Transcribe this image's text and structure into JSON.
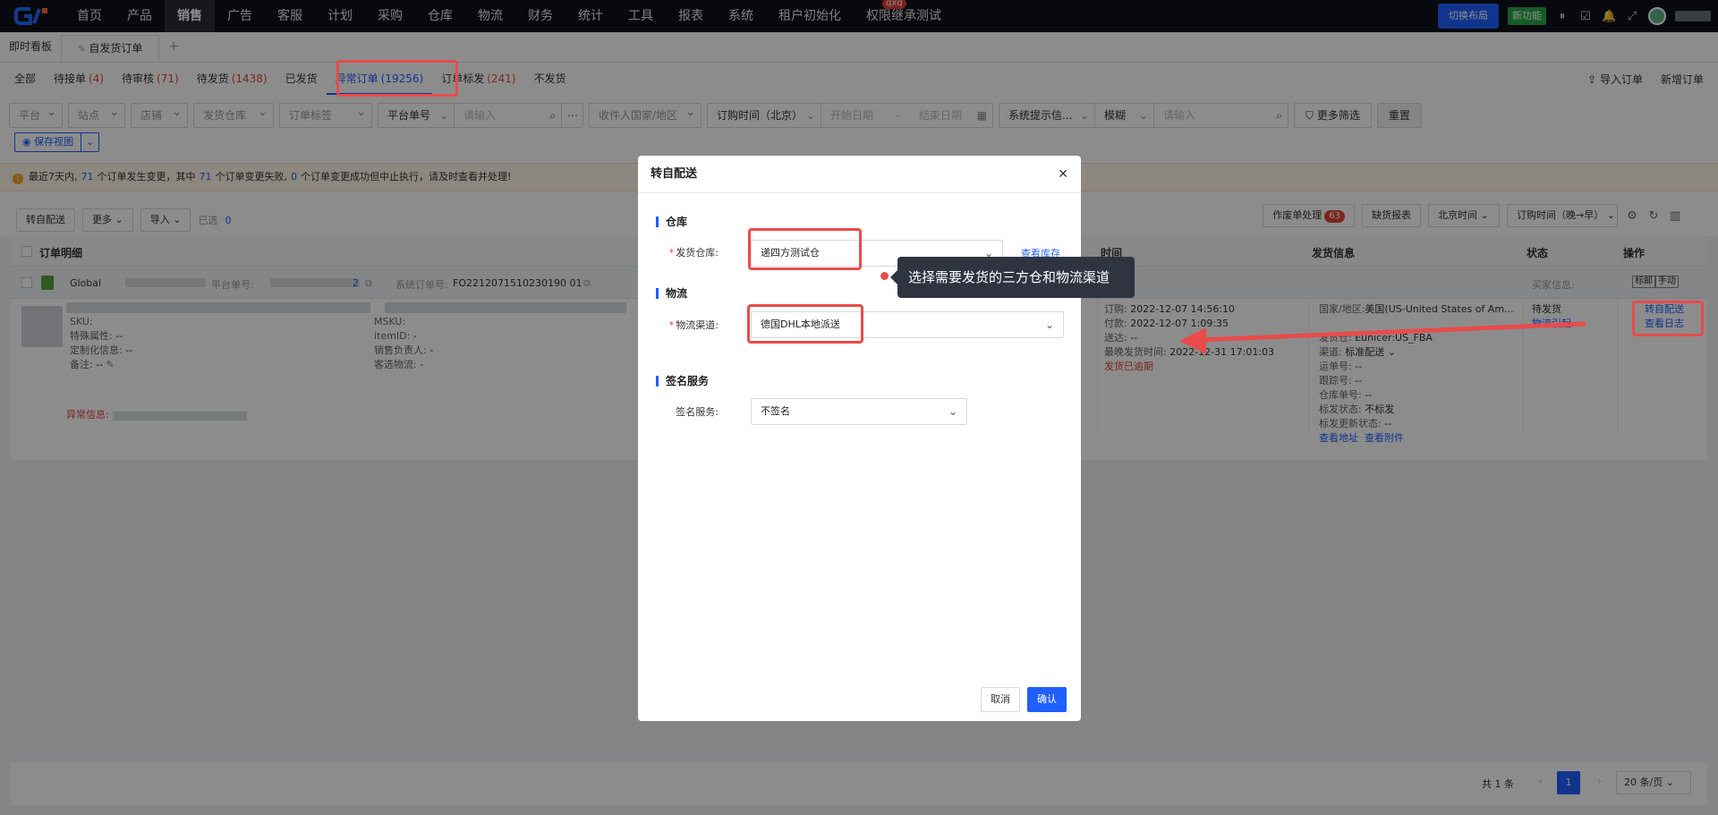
{
  "topnav": {
    "items": [
      "首页",
      "产品",
      "销售",
      "广告",
      "客服",
      "计划",
      "采购",
      "仓库",
      "物流",
      "财务",
      "统计",
      "工具",
      "报表",
      "系统",
      "租户初始化",
      "权限继承测试"
    ],
    "active_index": 2,
    "badge": "qxq",
    "switch_layout": "切换布局",
    "new_feature": "新功能"
  },
  "tabs": {
    "dashboard": "即时看板",
    "current": "自发货订单",
    "plus": "+"
  },
  "status_tabs": [
    {
      "label": "全部",
      "count": ""
    },
    {
      "label": "待接单",
      "count": "(4)"
    },
    {
      "label": "待审核",
      "count": "(71)"
    },
    {
      "label": "待发货",
      "count": "(1438)"
    },
    {
      "label": "已发货",
      "count": ""
    },
    {
      "label": "异常订单",
      "count": "(19256)"
    },
    {
      "label": "订单标发",
      "count": "(241)"
    },
    {
      "label": "不发货",
      "count": ""
    }
  ],
  "status_actions": {
    "import": "导入订单",
    "add": "新增订单"
  },
  "filters": {
    "platform": "平台",
    "site": "站点",
    "shop": "店铺",
    "warehouse": "发货仓库",
    "tag": "订单标签",
    "platform_no": "平台单号",
    "input_placeholder": "请输入",
    "country": "收件人国家/地区",
    "order_time": "订购时间（北京）",
    "start_date": "开始日期",
    "range_sep": "-",
    "end_date": "结束日期",
    "system_tip": "系统提示信...",
    "fuzzy": "模糊",
    "search_placeholder": "请输入",
    "more_filters": "更多筛选",
    "reset": "重置",
    "save_view": "保存视图"
  },
  "notice": {
    "p1": "最近7天内,",
    "n1": "71",
    "p2": "个订单发生变更，其中",
    "n2": "71",
    "p3": "个订单变更失败,",
    "n3": "0",
    "p4": "个订单变更成功但中止执行，请及时查看并处理!"
  },
  "toolbar": {
    "transfer": "转自配送",
    "more": "更多",
    "import": "导入",
    "selected": "已选",
    "selected_count": "0",
    "work_order": "作废单处理",
    "work_order_count": "63",
    "shortage": "缺货报表",
    "timezone": "北京时间",
    "sort": "订购时间（晚→早）"
  },
  "table": {
    "headers": {
      "detail": "订单明细",
      "time": "时间",
      "ship": "发货信息",
      "status": "状态",
      "action": "操作"
    },
    "group": {
      "platform": "Global",
      "platform_no_label": "平台单号:",
      "platform_no_tail": "2",
      "system_no_label": "系统订单号:",
      "system_no": "FO2212071510230190 01",
      "buyer_label": "买家信息:",
      "tag_mark": "标邮",
      "tag_manual": "手动"
    },
    "row": {
      "sku_label": "SKU:",
      "special_label": "特殊属性:",
      "special_value": "--",
      "custom_label": "定制化信息:",
      "custom_value": "--",
      "remark_label": "备注:",
      "remark_value": "--",
      "msku_label": "MSKU:",
      "itemid_label": "itemID:",
      "itemid_value": "-",
      "sales_label": "销售负责人:",
      "sales_value": "-",
      "logistics_label": "客选物流:",
      "logistics_value": "-",
      "exception_label": "异常信息:",
      "order_label": "订购:",
      "order_value": "2022-12-07 14:56:10",
      "pay_label": "付款:",
      "pay_value": "2022-12-07 1",
      "pay_tail": ":09:35",
      "arrive_label": "送达:",
      "arrive_value": "--",
      "latest_label": "最晚发货时间:",
      "latest_value": "2022-12-31 17:01:03",
      "overdue": "发货已逾期",
      "country_label": "国家/地区:",
      "country_value": "美国(US-United States of Am...",
      "ship_wh_label": "发货仓:",
      "ship_wh_value": "Eunicer:US_FBA",
      "channel_label": "渠道:",
      "channel_value": "标准配送",
      "tracking_label": "运单号:",
      "tracking_value": "--",
      "follow_label": "跟踪号:",
      "follow_value": "--",
      "wh_no_label": "仓库单号:",
      "wh_no_value": "--",
      "mark_status_label": "标发状态:",
      "mark_status_value": "不标发",
      "mark_update_label": "标发更新状态:",
      "mark_update_value": "--",
      "view_addr": "查看地址",
      "view_attach": "查看附件",
      "status": "待发货",
      "status_sub": "物流引起",
      "action": "转自配送",
      "action_log": "查看日志"
    }
  },
  "pager": {
    "total": "共 1 条",
    "page": "1",
    "size": "20 条/页"
  },
  "modal": {
    "title": "转自配送",
    "sec_warehouse": "仓库",
    "warehouse_label": "发货仓库:",
    "warehouse_value": "递四方测试仓",
    "view_stock": "查看库存",
    "sec_logistics": "物流",
    "channel_label": "物流渠道:",
    "channel_value": "德国DHL本地派送",
    "sec_sign": "签名服务",
    "sign_label": "签名服务:",
    "sign_value": "不签名",
    "cancel": "取消",
    "confirm": "确认"
  },
  "tooltip": "选择需要发货的三方仓和物流渠道"
}
